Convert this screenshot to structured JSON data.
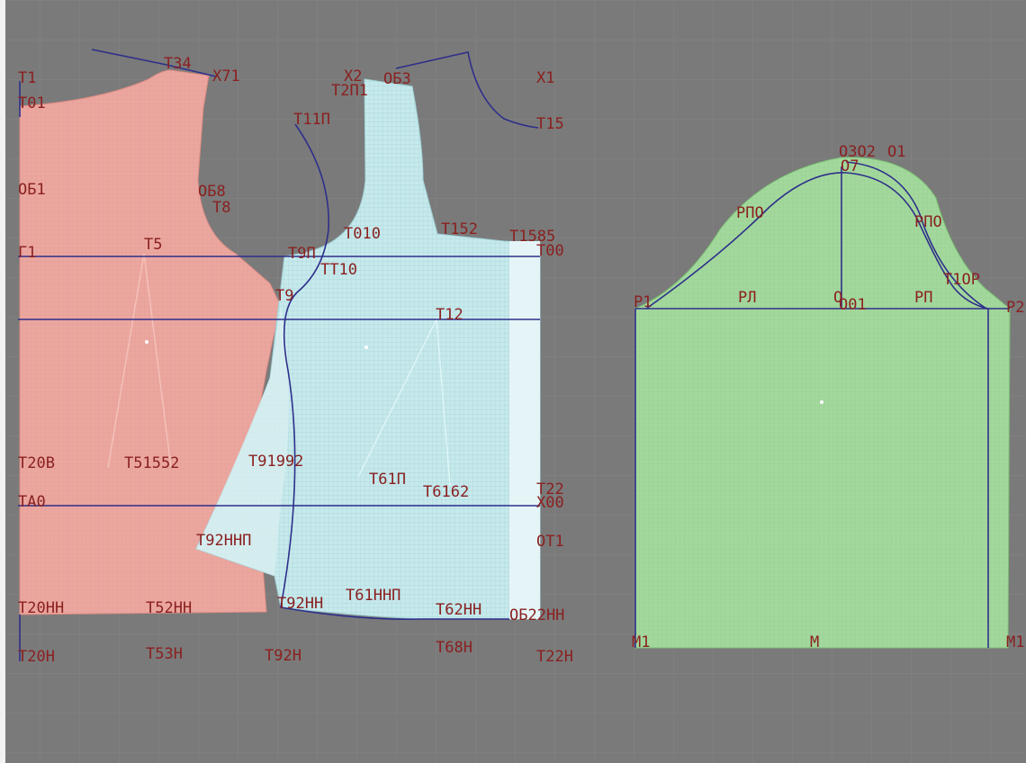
{
  "colors": {
    "background": "#7a7a7a",
    "grid": "#8a8a8a",
    "back_piece": "#e8a39b",
    "front_piece": "#bfe6ea",
    "sleeve_piece": "#9fd69a",
    "construction_line": "#2e2f8a",
    "label": "#8a2020"
  },
  "labels": {
    "t1": "T1",
    "t01": "T01",
    "t34": "T34",
    "x71": "X71",
    "ob1": "ОБ1",
    "ob8": "ОБ8",
    "t8": "T8",
    "g1": "Г1",
    "t5": "T5",
    "t20v": "T20B",
    "t51552": "T51552",
    "ta0": "TA0",
    "t20nn": "T20НН",
    "t52nn": "T52НН",
    "t20n": "T20Н",
    "t53n": "T53Н",
    "x2": "X2",
    "t201": "T2П1",
    "ob3": "ОБ3",
    "x1": "X1",
    "t15": "T15",
    "t11p": "T11П",
    "t010": "T010",
    "t9p": "T9П",
    "tt10": "TT10",
    "t152": "T152",
    "t1585": "T1585",
    "t00": "T00",
    "t9": "T9",
    "t12": "T12",
    "t91992": "T91992",
    "t61p": "T61П",
    "t6162": "T6162",
    "t22": "T22",
    "x00": "X00",
    "t92nnp": "T92ННП",
    "ot1": "ОТ1",
    "t92nn": "T92НН",
    "t61nnp": "T61ННП",
    "t62nnn": "T62НН",
    "ob22nn": "ОБ22НН",
    "t68n": "T68Н",
    "t22n": "T22Н",
    "t92n": "T92Н",
    "o302": "O3O2",
    "o1": "O1",
    "o7": "O7",
    "rpo": "PПО",
    "rpo2": "PПО",
    "t1or": "T1OP",
    "r1": "P1",
    "rl": "PЛ",
    "o": "O",
    "oo1": "O01",
    "rp": "PП",
    "r2": "P2",
    "m1": "M1",
    "m": "M",
    "m1b": "M1"
  }
}
